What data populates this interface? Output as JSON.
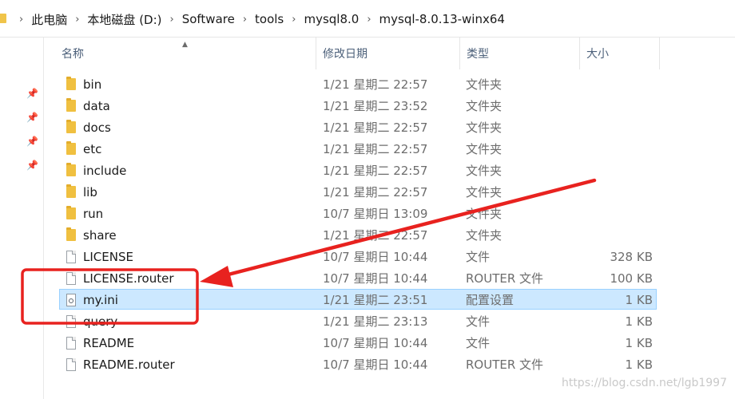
{
  "breadcrumb": [
    "此电脑",
    "本地磁盘 (D:)",
    "Software",
    "tools",
    "mysql8.0",
    "mysql-8.0.13-winx64"
  ],
  "breadcrumb_separator": "›",
  "columns": {
    "name": "名称",
    "date": "修改日期",
    "type": "类型",
    "size": "大小"
  },
  "files": [
    {
      "name": "bin",
      "date": "1/21 星期二 22:57",
      "type": "文件夹",
      "size": "",
      "icon": "folder-icon",
      "selected": false
    },
    {
      "name": "data",
      "date": "1/21 星期二 23:52",
      "type": "文件夹",
      "size": "",
      "icon": "folder-icon",
      "selected": false
    },
    {
      "name": "docs",
      "date": "1/21 星期二 22:57",
      "type": "文件夹",
      "size": "",
      "icon": "folder-icon",
      "selected": false
    },
    {
      "name": "etc",
      "date": "1/21 星期二 22:57",
      "type": "文件夹",
      "size": "",
      "icon": "folder-icon",
      "selected": false
    },
    {
      "name": "include",
      "date": "1/21 星期二 22:57",
      "type": "文件夹",
      "size": "",
      "icon": "folder-icon",
      "selected": false
    },
    {
      "name": "lib",
      "date": "1/21 星期二 22:57",
      "type": "文件夹",
      "size": "",
      "icon": "folder-icon",
      "selected": false
    },
    {
      "name": "run",
      "date": "10/7 星期日 13:09",
      "type": "文件夹",
      "size": "",
      "icon": "folder-icon",
      "selected": false
    },
    {
      "name": "share",
      "date": "1/21 星期二 22:57",
      "type": "文件夹",
      "size": "",
      "icon": "folder-icon",
      "selected": false
    },
    {
      "name": "LICENSE",
      "date": "10/7 星期日 10:44",
      "type": "文件",
      "size": "328 KB",
      "icon": "file-icon",
      "selected": false
    },
    {
      "name": "LICENSE.router",
      "date": "10/7 星期日 10:44",
      "type": "ROUTER 文件",
      "size": "100 KB",
      "icon": "file-icon",
      "selected": false
    },
    {
      "name": "my.ini",
      "date": "1/21 星期二 23:51",
      "type": "配置设置",
      "size": "1 KB",
      "icon": "config-icon",
      "selected": true
    },
    {
      "name": "query",
      "date": "1/21 星期二 23:13",
      "type": "文件",
      "size": "1 KB",
      "icon": "file-icon",
      "selected": false
    },
    {
      "name": "README",
      "date": "10/7 星期日 10:44",
      "type": "文件",
      "size": "1 KB",
      "icon": "file-icon",
      "selected": false
    },
    {
      "name": "README.router",
      "date": "10/7 星期日 10:44",
      "type": "ROUTER 文件",
      "size": "1 KB",
      "icon": "file-icon",
      "selected": false
    }
  ],
  "quick_access_pins": 4,
  "annotation_color": "#e8221f",
  "selection_color": "#cce8ff",
  "watermark": "https://blog.csdn.net/lgb1997"
}
